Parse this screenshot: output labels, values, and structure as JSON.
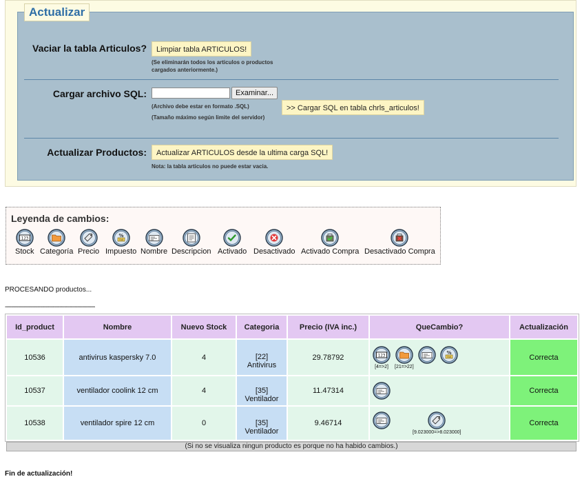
{
  "actualizar": {
    "legend": "Actualizar",
    "vaciar_label": "Vaciar la tabla Articulos?",
    "vaciar_button": "Limpiar tabla ARTICULOS!",
    "vaciar_note_1": "(Se eliminarán todos los articulos o productos",
    "vaciar_note_2": "cargados anteriormente.)",
    "cargar_label": "Cargar archivo SQL:",
    "browse_button": "Examinar...",
    "cargar_note_1": "(Archivo debe estar en formato .SQL)",
    "cargar_note_2": "(Tamaño máximo según limite del servidor)",
    "cargar_button": ">> Cargar SQL en tabla chrls_articulos!",
    "actualizar_label": "Actualizar Productos:",
    "actualizar_button": "Actualizar ARTICULOS desde la ultima carga SQL!",
    "actualizar_note": "Nota: la tabla articulos no puede estar vacia."
  },
  "leyenda": {
    "title": "Leyenda de cambios:",
    "items": [
      {
        "label": "Stock",
        "icon": "stock-icon"
      },
      {
        "label": "Categoría",
        "icon": "folder-icon"
      },
      {
        "label": "Precio",
        "icon": "price-tag-icon"
      },
      {
        "label": "Impuesto",
        "icon": "tax-icon"
      },
      {
        "label": "Nombre",
        "icon": "name-card-icon"
      },
      {
        "label": "Descripcion",
        "icon": "description-icon"
      },
      {
        "label": "Activado",
        "icon": "check-icon"
      },
      {
        "label": "Desactivado",
        "icon": "cross-icon"
      },
      {
        "label": "Activado Compra",
        "icon": "cart-check-icon"
      },
      {
        "label": "Desactivado Compra",
        "icon": "cart-cross-icon"
      }
    ]
  },
  "processing": {
    "text": "PROCESANDO productos...",
    "dashes": "--------------------------------------------------------",
    "fin": "Fin de actualización!"
  },
  "table": {
    "headers": [
      "Id_product",
      "Nombre",
      "Nuevo Stock",
      "Categoria",
      "Precio (IVA inc.)",
      "QueCambio?",
      "Actualización"
    ],
    "rows": [
      {
        "id": "10536",
        "nombre": "antivirus kaspersky 7.0",
        "stock": "4",
        "cat_id": "[22]",
        "cat_name": "Antivirus",
        "precio": "29.78792",
        "cambios": [
          {
            "icon": "stock-icon",
            "value": "[4=>2]"
          },
          {
            "icon": "folder-icon",
            "value": "[21=>22]"
          },
          {
            "icon": "name-card-icon",
            "value": ""
          },
          {
            "icon": "tax-icon",
            "value": ""
          }
        ],
        "estado": "Correcta"
      },
      {
        "id": "10537",
        "nombre": "ventilador coolink 12 cm",
        "stock": "4",
        "cat_id": "[35]",
        "cat_name": "Ventilador",
        "precio": "11.47314",
        "cambios": [
          {
            "icon": "name-card-icon",
            "value": ""
          }
        ],
        "estado": "Correcta"
      },
      {
        "id": "10538",
        "nombre": "ventilador spire 12 cm",
        "stock": "0",
        "cat_id": "[35]",
        "cat_name": "Ventilador",
        "precio": "9.46714",
        "cambios": [
          {
            "icon": "name-card-icon",
            "value": ""
          },
          {
            "icon": "price-tag-icon",
            "value": "[9.023000=>8.023000]"
          }
        ],
        "estado": "Correcta"
      }
    ],
    "footer": "(Si no se visualiza ningun producto es porque no ha habido cambios.)"
  },
  "colors": {
    "panel_bg": "#fdfbe3",
    "fieldset_bg": "#a9bfcd",
    "legend_text": "#2f6ea6",
    "button_bg": "#fdf5c4",
    "header_bg": "#e3c8f2",
    "row_green": "#e2f6ea",
    "row_blue": "#c7def4",
    "status_ok": "#7ef27a"
  }
}
